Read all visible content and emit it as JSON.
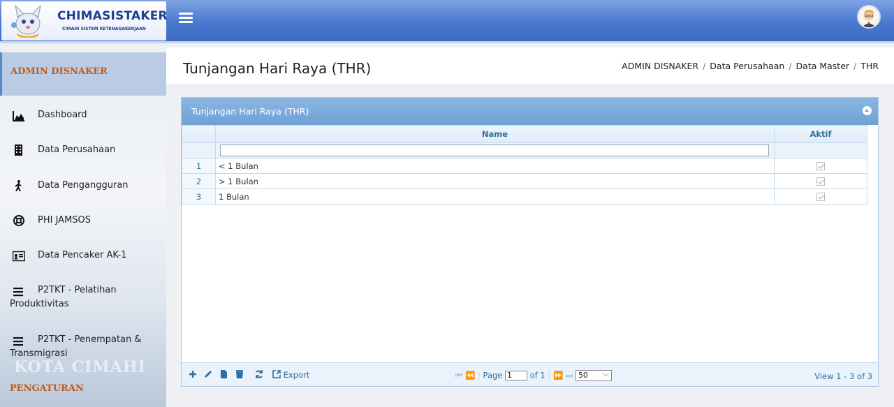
{
  "app": {
    "title": "CHIMASISTAKER",
    "subtitle": "CIMAHI SISTEM KETENAGAKERJAAN"
  },
  "sidebar": {
    "header": "ADMIN DISNAKER",
    "items": [
      {
        "label": "Dashboard",
        "icon": "area-chart-icon"
      },
      {
        "label": "Data Perusahaan",
        "icon": "building-icon"
      },
      {
        "label": "Data Pengangguran",
        "icon": "walking-person-icon"
      },
      {
        "label": "PHI JAMSOS",
        "icon": "life-ring-icon"
      },
      {
        "label": "Data Pencaker AK-1",
        "icon": "id-card-icon"
      },
      {
        "label": "P2TKT - Pelatihan",
        "label2": "Produktivitas",
        "icon": "bars-icon"
      },
      {
        "label": "P2TKT - Penempatan &",
        "label2": "Transmigrasi",
        "icon": "bars-icon"
      }
    ],
    "watermark": "KOTA CIMAHI",
    "section": "PENGATURAN"
  },
  "page": {
    "title": "Tunjangan Hari Raya (THR)",
    "breadcrumb": [
      "ADMIN DISNAKER",
      "Data Perusahaan",
      "Data Master",
      "THR"
    ]
  },
  "grid": {
    "caption": "Tunjangan Hari Raya (THR)",
    "columns": {
      "name": "Name",
      "aktif": "Aktif"
    },
    "rows": [
      {
        "no": "1",
        "name": "< 1 Bulan",
        "aktif": true
      },
      {
        "no": "2",
        "name": "> 1 Bulan",
        "aktif": true
      },
      {
        "no": "3",
        "name": "1 Bulan",
        "aktif": true
      }
    ],
    "pager": {
      "export_label": "Export",
      "page_label": "Page",
      "page_value": "1",
      "of_label": "of 1",
      "rows_per_page": "50",
      "view_info": "View 1 - 3 of 3"
    }
  },
  "colors": {
    "topbar": "#4b78cf",
    "accent": "#2e6e9e",
    "sidebar_heading": "#c25a1a"
  }
}
